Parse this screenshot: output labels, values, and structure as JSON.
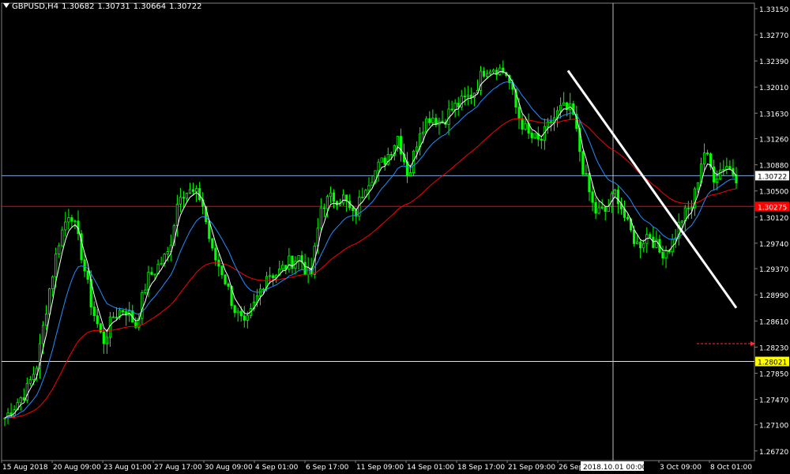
{
  "header": {
    "symbol": "GBPUSD,H4",
    "open": "1.30682",
    "high": "1.30731",
    "low": "1.30664",
    "close": "1.30722"
  },
  "colors": {
    "background": "#000000",
    "candles": "#00ff00",
    "fast_ma": "#ffffff",
    "medium_ma": "#1e90ff",
    "slow_ma": "#ff0000",
    "trendline": "#ffffff",
    "bid_line": "#7ea7d8",
    "support_line": "#ffff00",
    "resistance_line": "#ff0000",
    "crosshair": "#c0c0c0",
    "axis_text": "#ffffff"
  },
  "chart_data": {
    "type": "candlestick",
    "y_range": [
      1.2658,
      1.3323
    ],
    "y_ticks": [
      "1.33150",
      "1.32770",
      "1.32390",
      "1.32010",
      "1.31630",
      "1.31260",
      "1.30880",
      "1.30500",
      "1.30120",
      "1.29740",
      "1.29370",
      "1.28990",
      "1.28610",
      "1.28230",
      "1.27850",
      "1.27470",
      "1.27100",
      "1.26720"
    ],
    "x_ticks": [
      "15 Aug 2018",
      "20 Aug 09:00",
      "23 Aug 01:00",
      "27 Aug 17:00",
      "30 Aug 09:00",
      "4 Sep 01:00",
      "6 Sep 17:00",
      "11 Sep 09:00",
      "14 Sep 01:00",
      "18 Sep 17:00",
      "21 Sep 09:00",
      "26 Sep",
      "2018.10.01 00:00",
      "3 Oct 09:00",
      "8 Oct 01:00"
    ],
    "crosshair_time_label": "2018.10.01 00:00",
    "horizontal_lines": [
      {
        "label": "1.30722",
        "value": 1.30722,
        "kind": "bid"
      },
      {
        "label": "1.30275",
        "value": 1.30275,
        "kind": "resistance"
      },
      {
        "label": "1.28021",
        "value": 1.28021,
        "kind": "support"
      }
    ],
    "price_path": [
      [
        0,
        1.272
      ],
      [
        1,
        1.274
      ],
      [
        2,
        1.276
      ],
      [
        3,
        1.28
      ],
      [
        4,
        1.29
      ],
      [
        5,
        1.298
      ],
      [
        6,
        1.3025
      ],
      [
        7,
        1.296
      ],
      [
        8,
        1.288
      ],
      [
        9,
        1.283
      ],
      [
        10,
        1.287
      ],
      [
        11,
        1.288
      ],
      [
        12,
        1.2855
      ],
      [
        13,
        1.292
      ],
      [
        14,
        1.294
      ],
      [
        15,
        1.296
      ],
      [
        16,
        1.305
      ],
      [
        17,
        1.3048
      ],
      [
        18,
        1.304
      ],
      [
        19,
        1.296
      ],
      [
        20,
        1.293
      ],
      [
        21,
        1.288
      ],
      [
        22,
        1.285
      ],
      [
        23,
        1.289
      ],
      [
        24,
        1.293
      ],
      [
        25,
        1.293
      ],
      [
        26,
        1.2945
      ],
      [
        27,
        1.2955
      ],
      [
        28,
        1.292
      ],
      [
        29,
        1.303
      ],
      [
        30,
        1.304
      ],
      [
        31,
        1.304
      ],
      [
        32,
        1.301
      ],
      [
        33,
        1.306
      ],
      [
        34,
        1.308
      ],
      [
        35,
        1.31
      ],
      [
        36,
        1.313
      ],
      [
        37,
        1.307
      ],
      [
        38,
        1.314
      ],
      [
        39,
        1.316
      ],
      [
        40,
        1.315
      ],
      [
        41,
        1.317
      ],
      [
        42,
        1.318
      ],
      [
        43,
        1.3195
      ],
      [
        44,
        1.323
      ],
      [
        45,
        1.323
      ],
      [
        46,
        1.322
      ],
      [
        47,
        1.316
      ],
      [
        48,
        1.313
      ],
      [
        49,
        1.312
      ],
      [
        50,
        1.315
      ],
      [
        51,
        1.317
      ],
      [
        52,
        1.3165
      ],
      [
        53,
        1.308
      ],
      [
        54,
        1.302
      ],
      [
        55,
        1.302
      ],
      [
        56,
        1.305
      ],
      [
        57,
        1.3
      ],
      [
        58,
        1.297
      ],
      [
        59,
        1.299
      ],
      [
        60,
        1.296
      ],
      [
        61,
        1.297
      ],
      [
        62,
        1.301
      ],
      [
        63,
        1.303
      ],
      [
        64,
        1.311
      ],
      [
        65,
        1.307
      ],
      [
        66,
        1.309
      ],
      [
        67,
        1.3072
      ]
    ],
    "trendline": {
      "start": [
        1.3225
      ],
      "end": [
        1.288
      ]
    },
    "arrow_marker_value": 1.2828
  }
}
